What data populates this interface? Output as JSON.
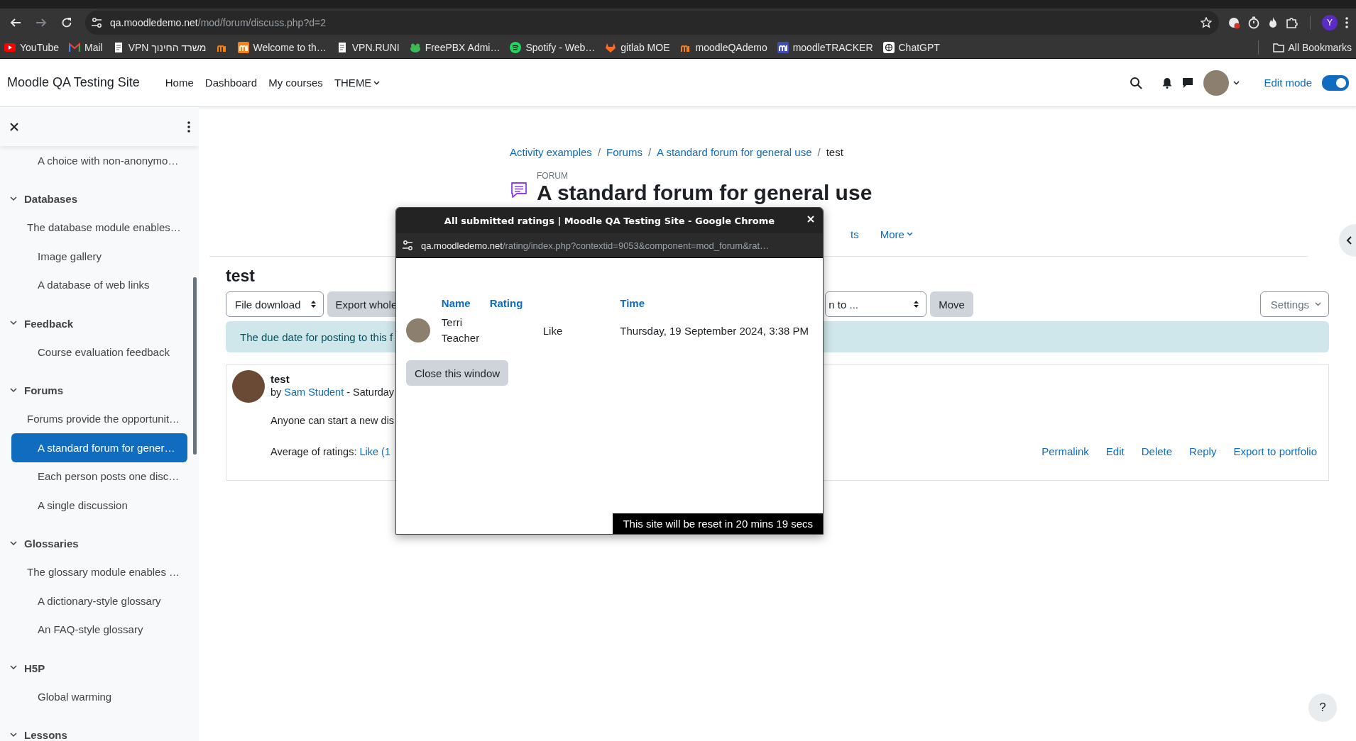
{
  "browser": {
    "address": {
      "host": "qa.moodledemo.net",
      "path": "/mod/forum/discuss.php?d=2"
    },
    "profile_initial": "Y",
    "bookmarks": [
      {
        "kind": "video",
        "label": "YouTube"
      },
      {
        "kind": "mail",
        "label": "Mail"
      },
      {
        "kind": "page",
        "label": "VPN משרד החינוך"
      },
      {
        "kind": "moodle"
      },
      {
        "kind": "moodle-box",
        "label": "Welcome to th…"
      },
      {
        "kind": "page",
        "label": "VPN.RUNI"
      },
      {
        "kind": "frog",
        "label": "FreePBX Admi…"
      },
      {
        "kind": "music",
        "label": "Spotify - Web…"
      },
      {
        "kind": "fox",
        "label": "gitlab MOE"
      },
      {
        "kind": "moodle",
        "label": "moodleQAdemo"
      },
      {
        "kind": "tracker",
        "label": "moodleTRACKER"
      },
      {
        "kind": "knot",
        "label": "ChatGPT"
      }
    ],
    "all_bookmarks": "All Bookmarks"
  },
  "navbar": {
    "site_name": "Moodle QA Testing Site",
    "menu": [
      {
        "label": "Home",
        "dropdown": false
      },
      {
        "label": "Dashboard",
        "dropdown": false
      },
      {
        "label": "My courses",
        "dropdown": false
      },
      {
        "label": "THEME",
        "dropdown": true
      }
    ],
    "edit_mode": {
      "label": "Edit mode",
      "on": true
    }
  },
  "sidebar": {
    "items": [
      {
        "kind": "activity",
        "label": "A choice with non-anonymo…",
        "selected": false
      },
      {
        "kind": "section",
        "label": "Databases",
        "expanded": true,
        "children": [
          {
            "kind": "intro",
            "label": "The database module enables…",
            "selected": false
          },
          {
            "kind": "activity",
            "label": "Image gallery",
            "selected": false
          },
          {
            "kind": "activity",
            "label": "A database of web links",
            "selected": false
          }
        ]
      },
      {
        "kind": "section",
        "label": "Feedback",
        "expanded": true,
        "children": [
          {
            "kind": "activity",
            "label": "Course evaluation feedback",
            "selected": false
          }
        ]
      },
      {
        "kind": "section",
        "label": "Forums",
        "expanded": true,
        "children": [
          {
            "kind": "intro",
            "label": "Forums provide the opportunit…",
            "selected": false
          },
          {
            "kind": "activity",
            "label": "A standard forum for gener…",
            "selected": true
          },
          {
            "kind": "activity",
            "label": "Each person posts one disc…",
            "selected": false
          },
          {
            "kind": "activity",
            "label": "A single discussion",
            "selected": false
          }
        ]
      },
      {
        "kind": "section",
        "label": "Glossaries",
        "expanded": true,
        "children": [
          {
            "kind": "intro",
            "label": "The glossary module enables …",
            "selected": false
          },
          {
            "kind": "activity",
            "label": "A dictionary-style glossary",
            "selected": false
          },
          {
            "kind": "activity",
            "label": "An FAQ-style glossary",
            "selected": false
          }
        ]
      },
      {
        "kind": "section",
        "label": "H5P",
        "expanded": true,
        "children": [
          {
            "kind": "activity",
            "label": "Global warming",
            "selected": false
          }
        ]
      },
      {
        "kind": "section",
        "label": "Lessons",
        "expanded": true
      }
    ]
  },
  "breadcrumb": [
    "Activity examples",
    "Forums",
    "A standard forum for general use",
    "test"
  ],
  "breadcrumb_separator": "/",
  "help_button": "?",
  "activity": {
    "type_label": "FORUM",
    "title": "A standard forum for general use"
  },
  "secondary_nav": [
    {
      "label": "ts",
      "dropdown": false
    },
    {
      "label": "More",
      "dropdown": true
    }
  ],
  "discussion": {
    "title": "test",
    "toolbar": [
      {
        "kind": "select",
        "label": "File download"
      },
      {
        "kind": "button",
        "label": "Export whole"
      },
      {
        "kind": "select",
        "label": "n to ..."
      },
      {
        "kind": "button",
        "label": "Move"
      }
    ],
    "settings": "Settings",
    "notice": "The due date for posting to this f",
    "post": {
      "title": "test",
      "by": "by",
      "author": "Sam Student",
      "meta": " - Saturday",
      "body": "Anyone can start a new dis",
      "ratings_label": "Average of ratings: ",
      "ratings_link": "Like (1",
      "actions": [
        "Permalink",
        "Edit",
        "Delete",
        "Reply",
        "Export to portfolio"
      ]
    }
  },
  "popup": {
    "title": "All submitted ratings | Moodle QA Testing Site - Google Chrome",
    "url": {
      "host": "qa.moodledemo.net",
      "path": "/rating/index.php?contextid=9053&component=mod_forum&rat…"
    },
    "columns": [
      "Name",
      "Rating",
      "Time"
    ],
    "rows": [
      {
        "name": "Terri Teacher",
        "rating": "Like",
        "time": "Thursday, 19 September 2024, 3:38 PM"
      }
    ],
    "close_button": "Close this window",
    "reset_notice": "This site will be reset in 20 mins 19 secs"
  }
}
